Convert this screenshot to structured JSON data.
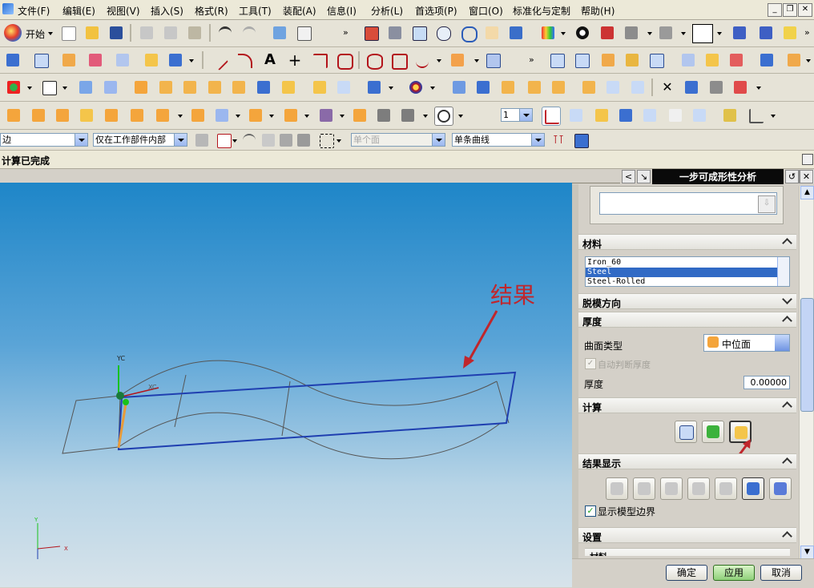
{
  "menu": {
    "items": [
      "文件(F)",
      "编辑(E)",
      "视图(V)",
      "插入(S)",
      "格式(R)",
      "工具(T)",
      "装配(A)",
      "信息(I)",
      "分析(L)",
      "首选项(P)",
      "窗口(O)",
      "标准化与定制",
      "帮助(H)"
    ]
  },
  "toolbar": {
    "start_label": "开始",
    "color_swatch": "#ffffff"
  },
  "selection": {
    "filter_value": "边",
    "scope_value": "仅在工作部件内部",
    "face_rule_value": "单个面",
    "curve_rule_value": "单条曲线"
  },
  "status": {
    "message": "计算已完成"
  },
  "viewport": {
    "annotation_text": "结果",
    "annotation_color": "#c0262c",
    "sheet_color": "#1f3fb0",
    "axis_label_yc": "YC",
    "axis_label_xc": "XC",
    "wcs_y_label": "Y",
    "wcs_x_label": "X"
  },
  "panel": {
    "title": "一步可成形性分析",
    "sections": {
      "material": "材料",
      "draw_direction": "脱模方向",
      "thickness": "厚度",
      "compute": "计算",
      "results": "结果显示",
      "settings": "设置",
      "cut_label": "材料"
    },
    "material_list": [
      "Iron_60",
      "Steel",
      "Steel-Rolled"
    ],
    "material_selected": "Steel",
    "surface_type_label": "曲面类型",
    "surface_type_value": "中位面",
    "auto_thickness_label": "自动判断厚度",
    "thickness_label": "厚度",
    "thickness_value": "0.00000",
    "show_boundary_label": "显示模型边界",
    "ok_label": "确定",
    "apply_label": "应用",
    "cancel_label": "取消"
  }
}
